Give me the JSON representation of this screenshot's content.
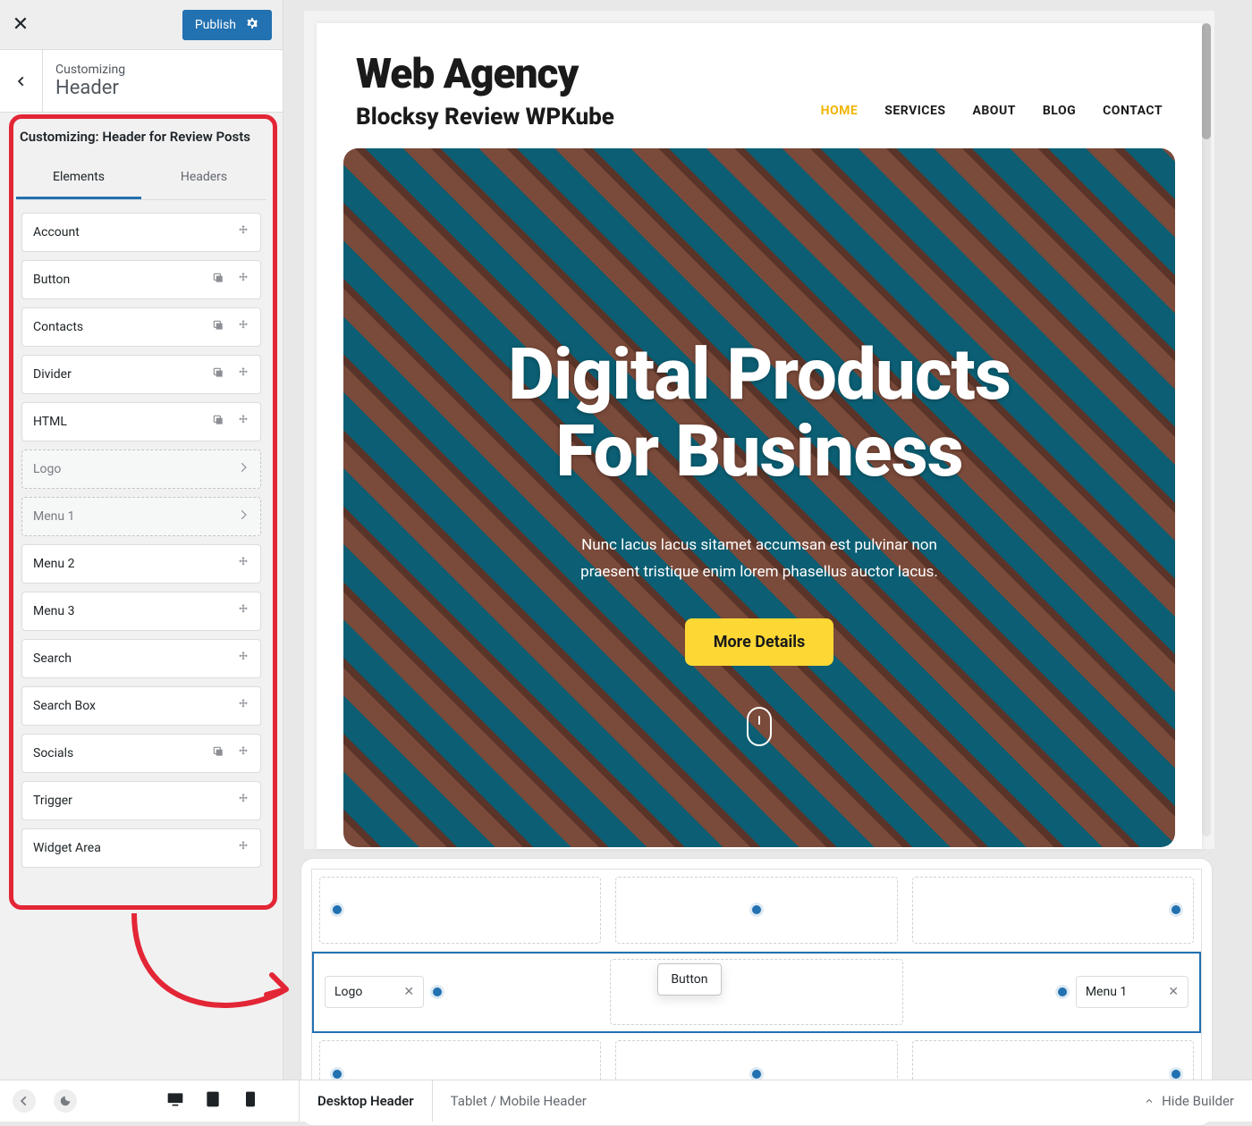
{
  "topbar": {
    "publish": "Publish"
  },
  "breadcrumb": {
    "customizing": "Customizing",
    "section": "Header"
  },
  "panel": {
    "title": "Customizing: Header for Review Posts",
    "tabs": [
      "Elements",
      "Headers"
    ],
    "active_tab": 0,
    "elements": [
      {
        "label": "Account",
        "clone": false,
        "drag": true,
        "used": false,
        "chevron": false
      },
      {
        "label": "Button",
        "clone": true,
        "drag": true,
        "used": false,
        "chevron": false
      },
      {
        "label": "Contacts",
        "clone": true,
        "drag": true,
        "used": false,
        "chevron": false
      },
      {
        "label": "Divider",
        "clone": true,
        "drag": true,
        "used": false,
        "chevron": false
      },
      {
        "label": "HTML",
        "clone": true,
        "drag": true,
        "used": false,
        "chevron": false
      },
      {
        "label": "Logo",
        "clone": false,
        "drag": false,
        "used": true,
        "chevron": true
      },
      {
        "label": "Menu 1",
        "clone": false,
        "drag": false,
        "used": true,
        "chevron": true
      },
      {
        "label": "Menu 2",
        "clone": false,
        "drag": true,
        "used": false,
        "chevron": false
      },
      {
        "label": "Menu 3",
        "clone": false,
        "drag": true,
        "used": false,
        "chevron": false
      },
      {
        "label": "Search",
        "clone": false,
        "drag": true,
        "used": false,
        "chevron": false
      },
      {
        "label": "Search Box",
        "clone": false,
        "drag": true,
        "used": false,
        "chevron": false
      },
      {
        "label": "Socials",
        "clone": true,
        "drag": true,
        "used": false,
        "chevron": false
      },
      {
        "label": "Trigger",
        "clone": false,
        "drag": true,
        "used": false,
        "chevron": false
      },
      {
        "label": "Widget Area",
        "clone": false,
        "drag": true,
        "used": false,
        "chevron": false
      }
    ]
  },
  "preview": {
    "logo_title": "Web Agency",
    "logo_sub": "Blocksy Review WPKube",
    "nav": [
      {
        "label": "HOME",
        "active": true
      },
      {
        "label": "SERVICES",
        "active": false
      },
      {
        "label": "ABOUT",
        "active": false
      },
      {
        "label": "BLOG",
        "active": false
      },
      {
        "label": "CONTACT",
        "active": false
      }
    ],
    "hero_line1": "Digital Products",
    "hero_line2": "For Business",
    "hero_para": "Nunc lacus lacus sitamet accumsan est pulvinar non praesent tristique enim lorem phasellus auctor lacus.",
    "cta": "More Details"
  },
  "builder": {
    "chip_left": "Logo",
    "chip_right": "Menu 1",
    "drag_item": "Button",
    "tabs": [
      "Desktop Header",
      "Tablet / Mobile Header"
    ],
    "active_tab": 0
  },
  "footer": {
    "hide": "Hide Builder"
  }
}
